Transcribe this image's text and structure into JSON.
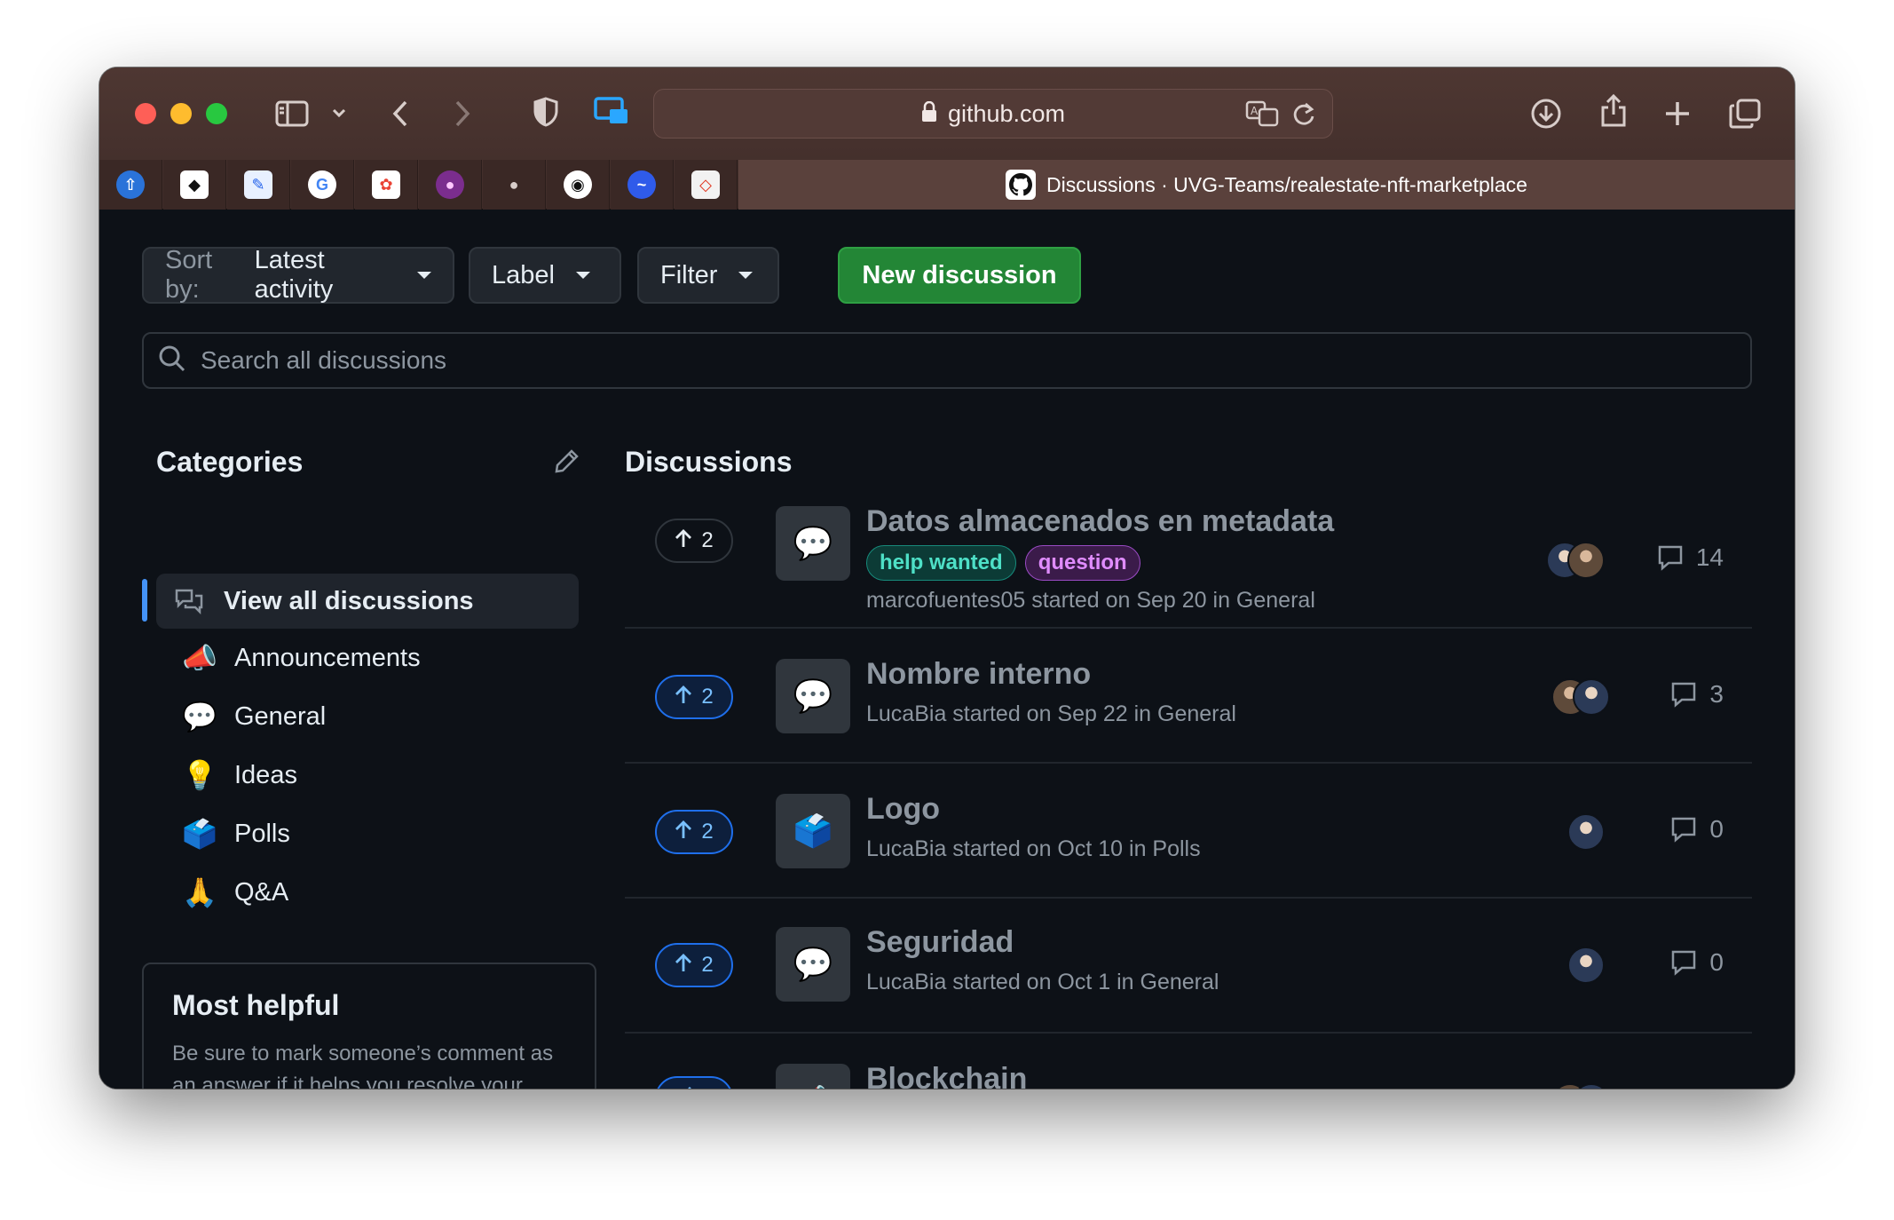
{
  "browser": {
    "url": "github.com",
    "active_tab_title": "Discussions · UVG-Teams/realestate-nft-marketplace"
  },
  "toolbar": {
    "sort_prefix": "Sort by:",
    "sort_value": "Latest activity",
    "label_button": "Label",
    "filter_button": "Filter",
    "new_discussion": "New discussion"
  },
  "search": {
    "placeholder": "Search all discussions"
  },
  "sidebar": {
    "title": "Categories",
    "items": [
      {
        "label": "View all discussions",
        "icon": "comment-discussion-icon"
      },
      {
        "label": "Announcements",
        "icon": "📣"
      },
      {
        "label": "General",
        "icon": "💬"
      },
      {
        "label": "Ideas",
        "icon": "💡"
      },
      {
        "label": "Polls",
        "icon": "🗳️"
      },
      {
        "label": "Q&A",
        "icon": "🙏"
      }
    ]
  },
  "helpful": {
    "title": "Most helpful",
    "text": "Be sure to mark someone’s comment as an answer if it helps you resolve your question — they deserve the credit! 💖"
  },
  "discussions": {
    "title": "Discussions",
    "rows": [
      {
        "votes": "2",
        "icon": "💬",
        "title": "Datos almacenados en metadata",
        "labels": [
          "help wanted",
          "question"
        ],
        "meta": "marcofuentes05 started on Sep 20 in General",
        "comments": "14"
      },
      {
        "votes": "2",
        "icon": "💬",
        "title": "Nombre interno",
        "meta": "LucaBia started on Sep 22 in General",
        "comments": "3"
      },
      {
        "votes": "2",
        "icon": "🗳️",
        "title": "Logo",
        "meta": "LucaBia started on Oct 10 in Polls",
        "comments": "0"
      },
      {
        "votes": "2",
        "icon": "💬",
        "title": "Seguridad",
        "meta": "LucaBia started on Oct 1 in General",
        "comments": "0"
      },
      {
        "votes": "",
        "icon": "📣",
        "title": "Blockchain",
        "meta": "",
        "comments": ""
      }
    ]
  }
}
